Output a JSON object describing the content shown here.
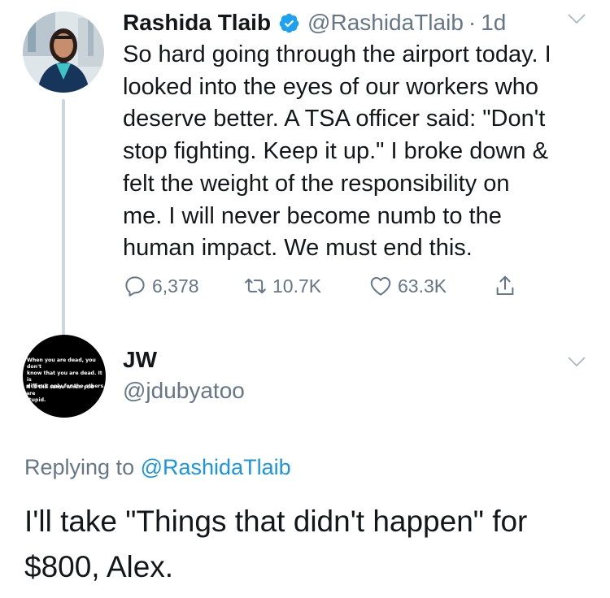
{
  "tweet": {
    "author_name": "Rashida Tlaib",
    "author_handle": "@RashidaTlaib",
    "separator": "·",
    "time": "1d",
    "verified_icon": "verified-badge-icon",
    "text": "So hard going through the airport today. I\nlooked into the eyes of our workers who\ndeserve better. A TSA officer said: \"Don't\nstop fighting. Keep it up.\" I broke down &\nfelt the weight of the responsibility on\nme. I will never become numb to the\nhuman impact. We must end this.",
    "actions": {
      "replies": "6,378",
      "retweets": "10.7K",
      "likes": "63.3K"
    }
  },
  "reply": {
    "author_name": "JW",
    "author_handle": "@jdubyatoo",
    "avatar_text_1": "When you are dead, you don't\nknow that you are dead. It is\ndifficult only for the others.",
    "avatar_text_2": "It is the same when you are\nstupid.",
    "replying_prefix": "Replying to",
    "replying_to": "@RashidaTlaib",
    "text": "I'll take \"Things that didn't happen\" for\n$800, Alex."
  },
  "colors": {
    "text_primary": "#14171a",
    "text_secondary": "#657786",
    "link": "#1b95e0",
    "verified": "#1da1f2",
    "thread_line": "#ccd6dd"
  }
}
